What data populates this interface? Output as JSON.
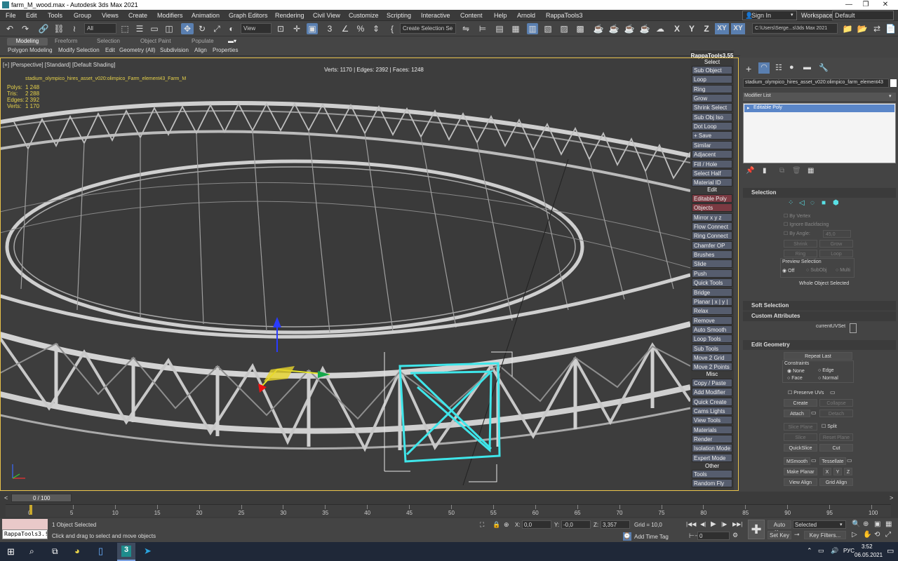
{
  "window": {
    "title": "farm_M_wood.max - Autodesk 3ds Max 2021"
  },
  "menu": [
    "File",
    "Edit",
    "Tools",
    "Group",
    "Views",
    "Create",
    "Modifiers",
    "Animation",
    "Graph Editors",
    "Rendering",
    "Civil View",
    "Customize",
    "Scripting",
    "Interactive",
    "Content",
    "Help",
    "Arnold",
    "RappaTools3"
  ],
  "account": {
    "sign_in": "Sign In",
    "workspaces_label": "Workspaces:",
    "workspace": "Default"
  },
  "toolbar": {
    "filter": "All",
    "view": "View",
    "selection_set": "Create Selection Se",
    "axes": [
      "X",
      "Y",
      "Z",
      "XY",
      "XY"
    ],
    "path": "C:\\Users\\Serge...s\\3ds Max 2021"
  },
  "ribbon": {
    "tabs": [
      "Modeling",
      "Freeform",
      "Selection",
      "Object Paint",
      "Populate"
    ],
    "subtabs": [
      "Polygon Modeling",
      "Modify Selection",
      "Edit",
      "Geometry (All)",
      "Subdivision",
      "Align",
      "Properties"
    ]
  },
  "viewport": {
    "label": "[+] [Perspective] [Standard] [Default Shading]",
    "summary": "Verts: 1170 | Edges: 2392 | Faces: 1248",
    "object_name": "stadium_olympico_hires_asset_v020:olimpico_Farm_element43_Farm_M",
    "stats": [
      {
        "label": "Polys:",
        "value": "1 248"
      },
      {
        "label": "Tris:",
        "value": "2 288"
      },
      {
        "label": "Edges:",
        "value": "2 392"
      },
      {
        "label": "Verts:",
        "value": "1 170"
      }
    ]
  },
  "rappa": {
    "title": "RappaTools3.55",
    "sections": {
      "select": "Select",
      "edit": "Edit",
      "misc": "Misc",
      "other": "Other"
    },
    "select_buttons": [
      "Sub Object",
      "Loop",
      "Ring",
      "Grow Selection",
      "Shrink Select",
      "Sub Obj Iso",
      "Dot Loop",
      "+ Save",
      "Similar",
      "Adjacent",
      "Fill / Hole",
      "Select Half",
      "Material ID"
    ],
    "edit_buttons": [
      "Editable Poly",
      "Objects Actions",
      "Mirror    x  y  z",
      "Flow Connect",
      "Ring Connect",
      "Chamfer OP",
      "Brushes",
      "Slide",
      "Push",
      "Quick Tools",
      "Bridge",
      "Planar | x | y | z",
      "Relax",
      "Remove",
      "Auto Smooth",
      "Loop Tools",
      "Sub Tools",
      "Move 2 Grid",
      "Move 2 Points"
    ],
    "misc_buttons": [
      "Copy / Paste",
      "Add Modifier",
      "Quick Create",
      "Cams Lights",
      "View Tools",
      "Materials",
      "Render",
      "Isolation Mode",
      "Expert Mode"
    ],
    "other_buttons": [
      "Tools",
      "Random Fly"
    ]
  },
  "command_panel": {
    "object_name": "stadium_olympico_hires_asset_v020:olimpico_farm_element43",
    "modifier_list": "Modifier List",
    "stack_item": "Editable Poly",
    "selection": {
      "title": "Selection",
      "by_vertex": "By Vertex",
      "ignore_backfacing": "Ignore Backfacing",
      "by_angle": "By Angle:",
      "angle": "45,0",
      "shrink": "Shrink",
      "grow": "Grow",
      "ring": "Ring",
      "loop": "Loop",
      "preview": "Preview Selection",
      "off": "Off",
      "subobj": "SubObj",
      "multi": "Multi",
      "whole": "Whole Object Selected"
    },
    "soft_selection": "Soft Selection",
    "custom_attributes": "Custom Attributes",
    "current_uv_set": "currentUVSet",
    "edit_geometry": {
      "title": "Edit Geometry",
      "repeat_last": "Repeat Last",
      "constraints": "Constraints",
      "none": "None",
      "edge": "Edge",
      "face": "Face",
      "normal": "Normal",
      "preserve_uvs": "Preserve UVs",
      "create": "Create",
      "collapse": "Collapse",
      "attach": "Attach",
      "detach": "Detach",
      "slice_plane": "Slice Plane",
      "split": "Split",
      "slice": "Slice",
      "reset_plane": "Reset Plane",
      "quickslice": "QuickSlice",
      "cut": "Cut",
      "msmooth": "MSmooth",
      "tessellate": "Tessellate",
      "make_planar": "Make Planar",
      "x": "X",
      "y": "Y",
      "z": "Z",
      "view_align": "View Align",
      "grid_align": "Grid Align"
    }
  },
  "timeline": {
    "frame": "0 / 100",
    "ticks": [
      "0",
      "5",
      "10",
      "15",
      "20",
      "25",
      "30",
      "35",
      "40",
      "45",
      "50",
      "55",
      "60",
      "65",
      "70",
      "75",
      "80",
      "85",
      "90",
      "95",
      "100"
    ]
  },
  "status": {
    "script_label": "RappaTools3.!",
    "selected": "1 Object Selected",
    "prompt": "Click and drag to select and move objects",
    "x": "0,0",
    "y": "-0,0",
    "z": "3,357",
    "grid": "Grid = 10,0",
    "add_time_tag": "Add Time Tag",
    "auto_key": "Auto Key",
    "set_key": "Set Key",
    "selected_dropdown": "Selected",
    "key_filters": "Key Filters...",
    "frame_field": "0"
  },
  "taskbar": {
    "lang": "РУС",
    "time": "3:52",
    "date": "06.05.2021"
  }
}
